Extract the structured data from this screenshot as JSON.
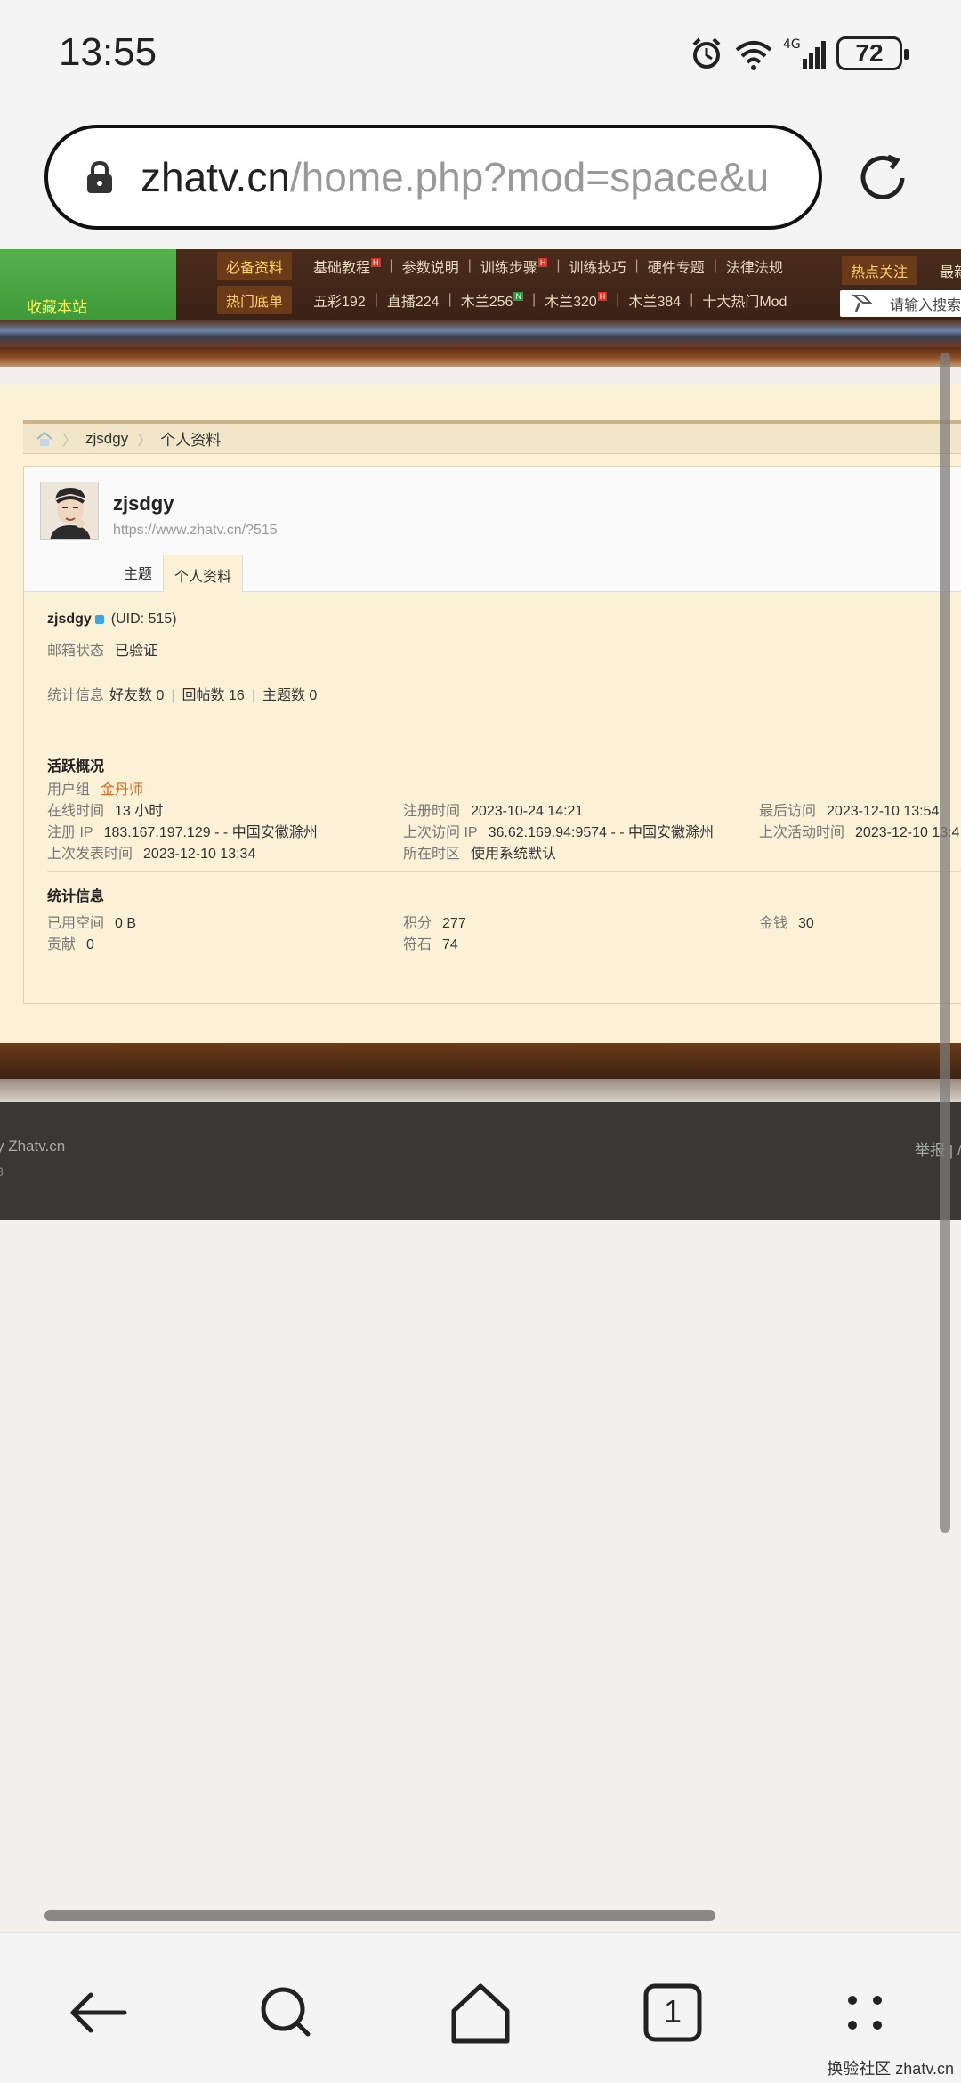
{
  "status_bar": {
    "time": "13:55",
    "battery": "72"
  },
  "url_bar": {
    "host": "zhatv.cn",
    "path": "/home.php?mod=space&u"
  },
  "site_nav": {
    "favorite": "收藏本站",
    "row1_tag": "必备资料",
    "row1_items": [
      {
        "label": "基础教程",
        "badge": "H"
      },
      {
        "label": "参数说明",
        "badge": ""
      },
      {
        "label": "训练步骤",
        "badge": "H"
      },
      {
        "label": "训练技巧",
        "badge": ""
      },
      {
        "label": "硬件专题",
        "badge": ""
      },
      {
        "label": "法律法规",
        "badge": ""
      }
    ],
    "row2_tag": "热门底单",
    "row2_items": [
      {
        "label": "五彩192",
        "badge": ""
      },
      {
        "label": "直播224",
        "badge": ""
      },
      {
        "label": "木兰256",
        "badge": "N"
      },
      {
        "label": "木兰320",
        "badge": "H"
      },
      {
        "label": "木兰384",
        "badge": ""
      },
      {
        "label": "十大热门Mod",
        "badge": ""
      }
    ],
    "hot_tag": "热点关注",
    "hot_more": "最新",
    "search_placeholder": "请输入搜索"
  },
  "breadcrumb": {
    "user": "zjsdgy",
    "current": "个人资料"
  },
  "profile": {
    "username": "zjsdgy",
    "link": "https://www.zhatv.cn/?515",
    "tabs": [
      "主题",
      "个人资料"
    ],
    "uid": "(UID: 515)",
    "email_label": "邮箱状态",
    "email_value": "已验证",
    "stats_label": "统计信息",
    "friends": "好友数 0",
    "replies": "回帖数 16",
    "threads": "主题数 0",
    "activity_title": "活跃概况",
    "group_label": "用户组",
    "group_value": "金丹师",
    "online_label": "在线时间",
    "online_value": "13 小时",
    "reg_time_label": "注册时间",
    "reg_time_value": "2023-10-24 14:21",
    "last_visit_label": "最后访问",
    "last_visit_value": "2023-12-10 13:54",
    "reg_ip_label": "注册 IP",
    "reg_ip_value": "183.167.197.129 - - 中国安徽滁州",
    "last_ip_label": "上次访问 IP",
    "last_ip_value": "36.62.169.94:9574 - - 中国安徽滁州",
    "last_active_label": "上次活动时间",
    "last_active_value": "2023-12-10 13:4",
    "last_post_label": "上次发表时间",
    "last_post_value": "2023-12-10 13:34",
    "tz_label": "所在时区",
    "tz_value": "使用系统默认",
    "stats_title": "统计信息",
    "space_label": "已用空间",
    "space_value": "0 B",
    "points_label": "积分",
    "points_value": "277",
    "money_label": "金钱",
    "money_value": "30",
    "contrib_label": "贡献",
    "contrib_value": "0",
    "stone_label": "符石",
    "stone_value": "74"
  },
  "footer": {
    "powered": "y Zhatv.cn",
    "year": "3",
    "report": "举报 | /"
  },
  "bottom_nav": {
    "tab_count": "1"
  },
  "watermark": "换验社区 zhatv.cn",
  "colors": {
    "nav_bg": "#3a2216",
    "content_bg": "#fbf1d6",
    "accent_green": "#3e9a39",
    "accent_gold": "#d86a1d"
  }
}
